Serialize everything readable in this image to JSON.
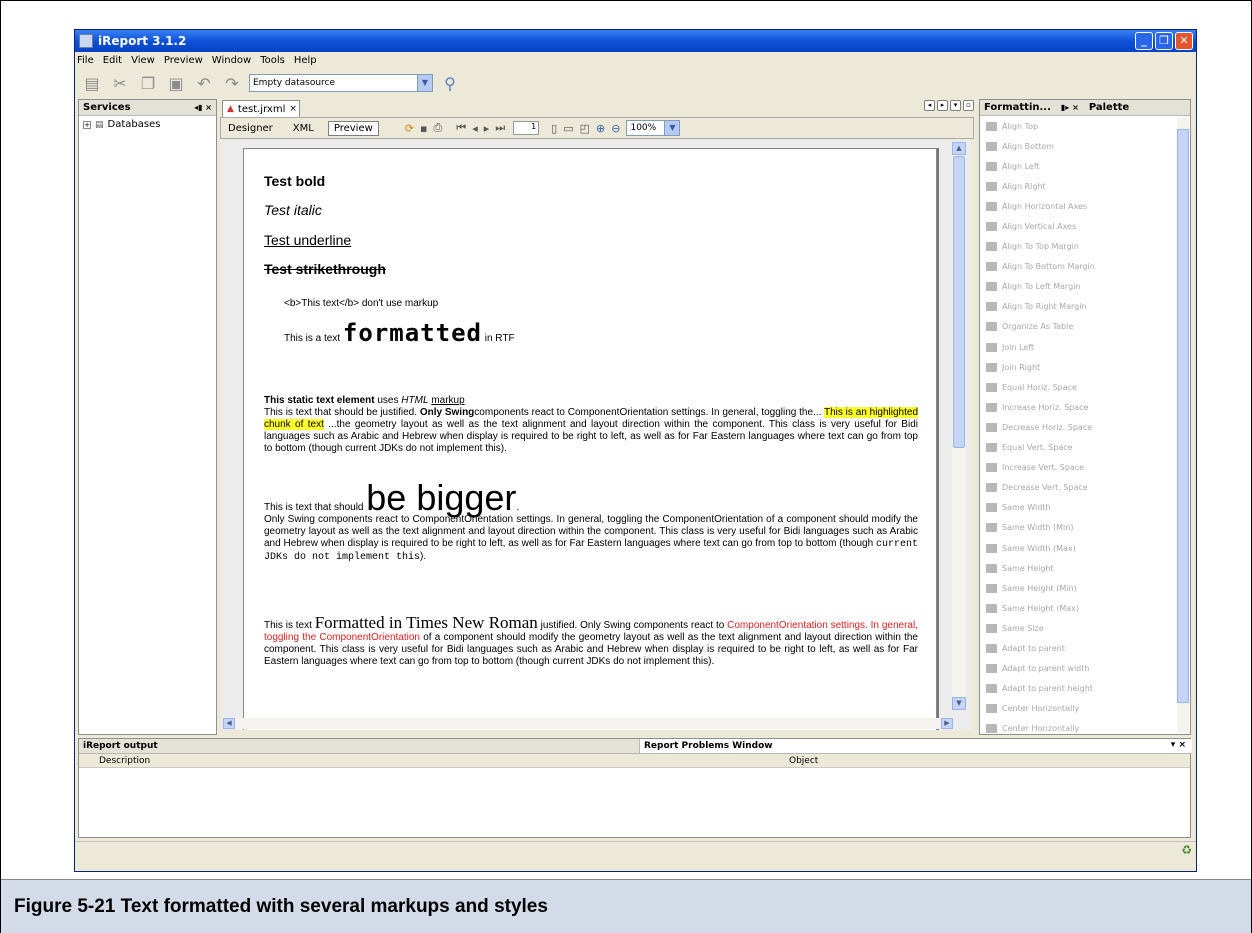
{
  "window": {
    "title": "iReport 3.1.2"
  },
  "menu": [
    "File",
    "Edit",
    "View",
    "Preview",
    "Window",
    "Tools",
    "Help"
  ],
  "toolbar": {
    "datasource": "Empty datasource"
  },
  "services": {
    "title": "Services",
    "tree_item": "Databases"
  },
  "editor": {
    "tab": "test.jrxml",
    "views": [
      "Designer",
      "XML",
      "Preview"
    ],
    "page_number": "1",
    "zoom": "100%"
  },
  "report": {
    "bold": "Test bold",
    "italic": "Test italic",
    "underline": "Test underline",
    "strike": "Test strikethrough",
    "no_markup": "<b>This text</b> don't use markup",
    "rtf_pre": "This is a text",
    "rtf_word": "formatted",
    "rtf_post": "in RTF",
    "html_bold": "This static text element",
    "html_uses": "uses",
    "html_italic": "HTML",
    "html_underline": "markup",
    "html_p1": "This is text that should be justified.",
    "html_p1_bold": "Only Swing",
    "html_p1_b": "components react to ComponentOrientation settings. In general, toggling the...",
    "html_highlight": "This is an highlighted chunk of text",
    "html_p1_c": "...the geometry layout as well as the text alignment and layout direction within the component. This class is very useful for Bidi languages such as Arabic and Hebrew when display is required to be right to left, as well as for Far Eastern languages where text can go from top to bottom (though current JDKs do not implement this).",
    "big_pre": "This is text that should",
    "big_word": "be bigger",
    "big_post": ".",
    "big_p": "Only Swing components react to ComponentOrientation settings. In general, toggling the ComponentOrientation of a component should modify the geometry layout as well as the text alignment and layout direction within the component. This class is very useful for Bidi languages such as Arabic and Hebrew when display is required to be right to left, as well as for Far Eastern languages where text can go from top to bottom (though",
    "big_mono": "current JDKs do not implement this",
    "big_end": ").",
    "times_pre": "This is text",
    "times_word": "Formatted in Times New Roman",
    "times_post": "justified. Only Swing components react to",
    "times_red": "ComponentOrientation settings. In general, toggling the ComponentOrientation",
    "times_rest": "of a component should modify the geometry layout as well as the text alignment and layout direction within the component. This class is very useful for Bidi languages such as Arabic and Hebrew when display is required to be right to left, as well as for Far Eastern languages where text can go from top to bottom (though current JDKs do not implement this)."
  },
  "formatting": {
    "tab": "Formattin...",
    "tab2": "Palette",
    "items": [
      "Align Top",
      "Align Bottom",
      "Align Left",
      "Align Right",
      "Align Horizontal Axes",
      "Align Vertical Axes",
      "Align To Top Margin",
      "Align To Bottom Margin",
      "Align To Left Margin",
      "Align To Right Margin",
      "Organize As Table",
      "Join Left",
      "Join Right",
      "Equal Horiz. Space",
      "Increase Horiz. Space",
      "Decrease Horiz. Space",
      "Equal Vert. Space",
      "Increase Vert. Space",
      "Decrease Vert. Space",
      "Same Width",
      "Same Width (Min)",
      "Same Width (Max)",
      "Same Height",
      "Same Height (Min)",
      "Same Height (Max)",
      "Same Size",
      "Adapt to parent",
      "Adapt to parent width",
      "Adapt to parent height",
      "Center Horizontally",
      "Center Horizontally"
    ]
  },
  "bottom": {
    "output": "iReport output",
    "problems": "Report Problems Window",
    "col_description": "Description",
    "col_object": "Object"
  },
  "caption": "Figure 5-21    Text formatted with several markups and styles"
}
